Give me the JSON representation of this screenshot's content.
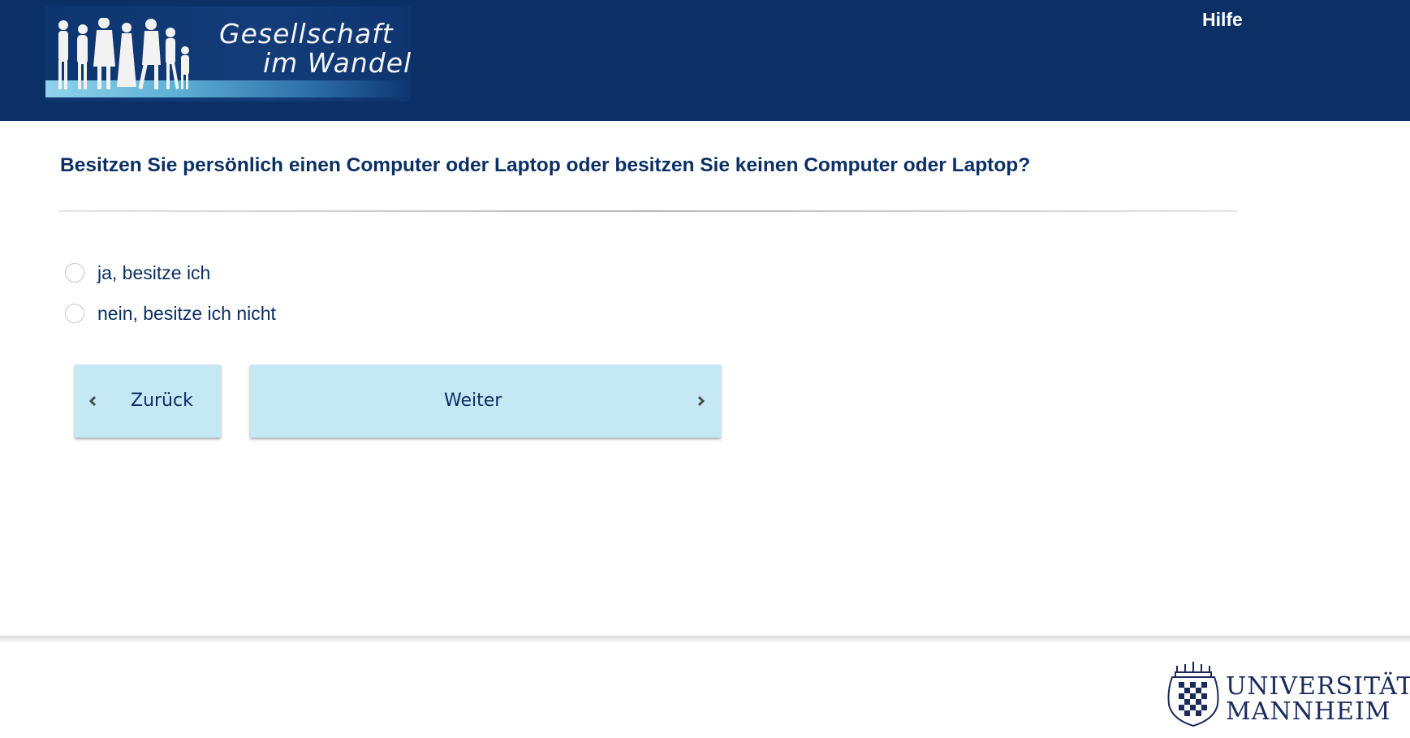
{
  "header": {
    "logo_line1": "Gesellschaft",
    "logo_line2": "im Wandel",
    "help_label": "Hilfe",
    "background_color": "#0b3065"
  },
  "question": {
    "text": "Besitzen Sie persönlich einen Computer oder Laptop oder besitzen Sie keinen Computer oder Laptop?"
  },
  "options": [
    {
      "label": "ja, besitze ich",
      "selected": false
    },
    {
      "label": "nein, besitze ich nicht",
      "selected": false
    }
  ],
  "navigation": {
    "back_label": "Zurück",
    "back_icon": "chevron-left-icon",
    "next_label": "Weiter",
    "next_icon": "chevron-right-icon",
    "button_color": "#c5e8f5"
  },
  "footer": {
    "university_line1": "UNIVERSITÄT",
    "university_line2": "MANNHEIM"
  }
}
